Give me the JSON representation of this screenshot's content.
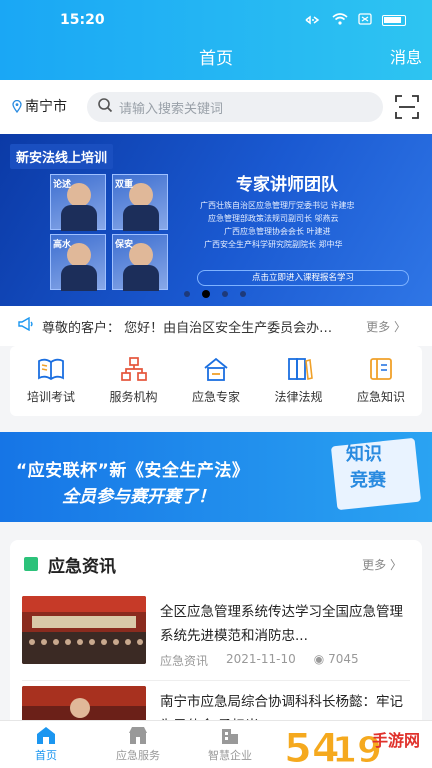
{
  "status_bar": {
    "time": "15:20"
  },
  "header": {
    "title": "首页",
    "messages_label": "消息"
  },
  "search": {
    "city": "南宁市",
    "placeholder": "请输入搜索关键词"
  },
  "banner": {
    "tag": "新安法线上培训",
    "team_title": "专家讲师团队",
    "lines": [
      "广西壮族自治区应急管理厅党委书记  许建忠",
      "应急管理部政策法规司副司长  邬燕云",
      "广西应急管理协会会长  叶建进",
      "广西安全生产科学研究院副院长  郑中华"
    ],
    "cta": "点击立即进入课程报名学习",
    "photo_captions": [
      "论述",
      "双重",
      "高水",
      "保安"
    ],
    "active_slide": 2,
    "slide_count": 4
  },
  "notice": {
    "text": "尊敬的客户：  您好！由自治区安全生产委员会办…",
    "more": "更多"
  },
  "quick_menu": [
    {
      "label": "培训考试",
      "icon": "book-icon"
    },
    {
      "label": "服务机构",
      "icon": "org-chart-icon"
    },
    {
      "label": "应急专家",
      "icon": "expert-icon"
    },
    {
      "label": "法律法规",
      "icon": "law-icon"
    },
    {
      "label": "应急知识",
      "icon": "knowledge-icon"
    }
  ],
  "promo": {
    "line1": "“应安联杯”新《安全生产法》",
    "line2": "全员参与赛开赛了！",
    "badge1": "知识",
    "badge2": "竞赛"
  },
  "news": {
    "title": "应急资讯",
    "more": "更多",
    "articles": [
      {
        "title": "全区应急管理系统传达学习全国应急管理系统先进模范和消防忠...",
        "category": "应急资讯",
        "date": "2021-11-10",
        "views": "7045"
      },
      {
        "title": "南宁市应急局综合协调科科长杨懿：牢记为民使命 勇担当",
        "category": "",
        "date": "",
        "views": ""
      }
    ]
  },
  "tabbar": [
    {
      "label": "首页",
      "active": true
    },
    {
      "label": "应急服务",
      "active": false
    },
    {
      "label": "智慧企业",
      "active": false
    }
  ],
  "watermark": {
    "text": "手游网",
    "sub": "54",
    "site": "5419"
  },
  "colors": {
    "accent": "#1b96f0",
    "header": "#1aa7f5",
    "green": "#2cc27a"
  }
}
